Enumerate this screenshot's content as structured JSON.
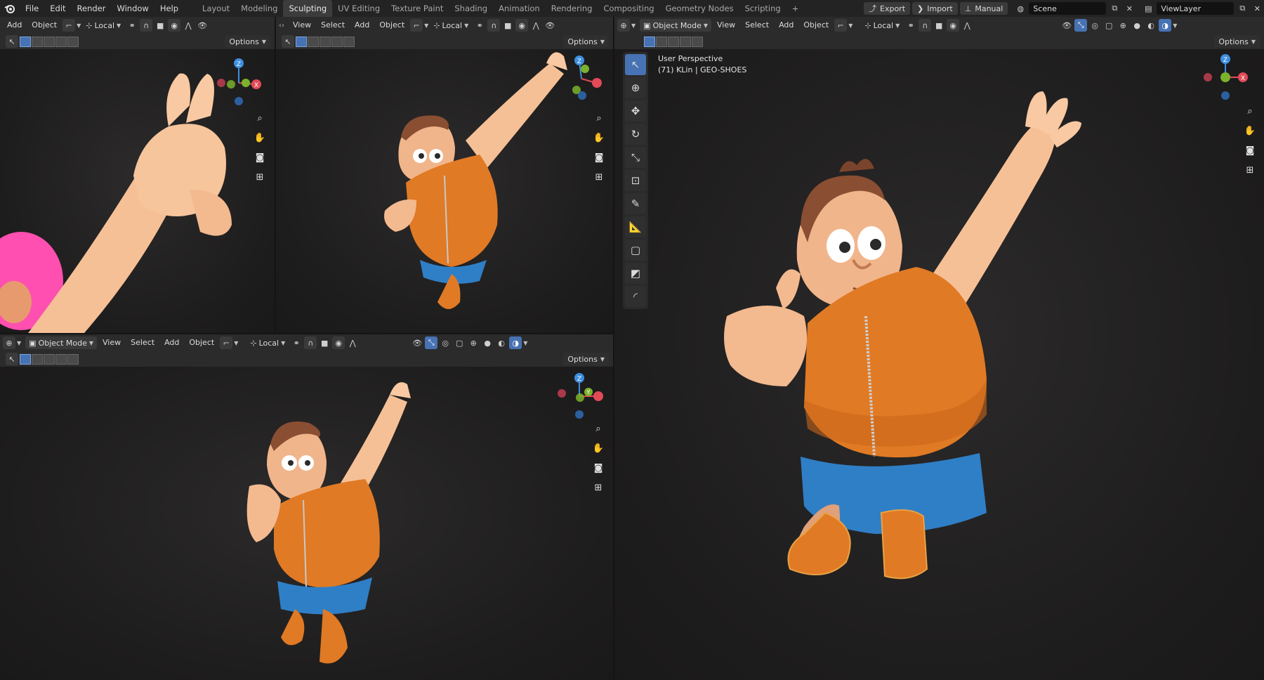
{
  "menu": [
    "File",
    "Edit",
    "Render",
    "Window",
    "Help"
  ],
  "workspaces": [
    "Layout",
    "Modeling",
    "Sculpting",
    "UV Editing",
    "Texture Paint",
    "Shading",
    "Animation",
    "Rendering",
    "Compositing",
    "Geometry Nodes",
    "Scripting"
  ],
  "active_workspace": "Sculpting",
  "add_workspace": "+",
  "top_right": {
    "export": "Export",
    "import": "Import",
    "manual": "Manual",
    "scene": "Scene",
    "view_layer": "ViewLayer"
  },
  "vp1": {
    "add": "Add",
    "object": "Object",
    "orientation": "Local",
    "options": "Options"
  },
  "vp2": {
    "view": "View",
    "select": "Select",
    "add": "Add",
    "object": "Object",
    "orientation": "Local",
    "options": "Options"
  },
  "vp3": {
    "mode": "Object Mode",
    "view": "View",
    "select": "Select",
    "add": "Add",
    "object": "Object",
    "orientation": "Local",
    "options": "Options"
  },
  "vp4": {
    "mode": "Object Mode",
    "view": "View",
    "select": "Select",
    "add": "Add",
    "object": "Object",
    "orientation": "Local",
    "options": "Options",
    "perspective": "User Perspective",
    "object_info": "(71) KLin | GEO-SHOES"
  },
  "gizmo": {
    "z": "Z",
    "y": "Y",
    "x": "X"
  },
  "colors": {
    "accent": "#4772b3",
    "x_axis": "#e24a57",
    "y_axis": "#7bb22c",
    "z_axis": "#3d8fe0",
    "vest": "#e07a25",
    "shorts": "#2f7fc6",
    "skin": "#f0b48a"
  }
}
